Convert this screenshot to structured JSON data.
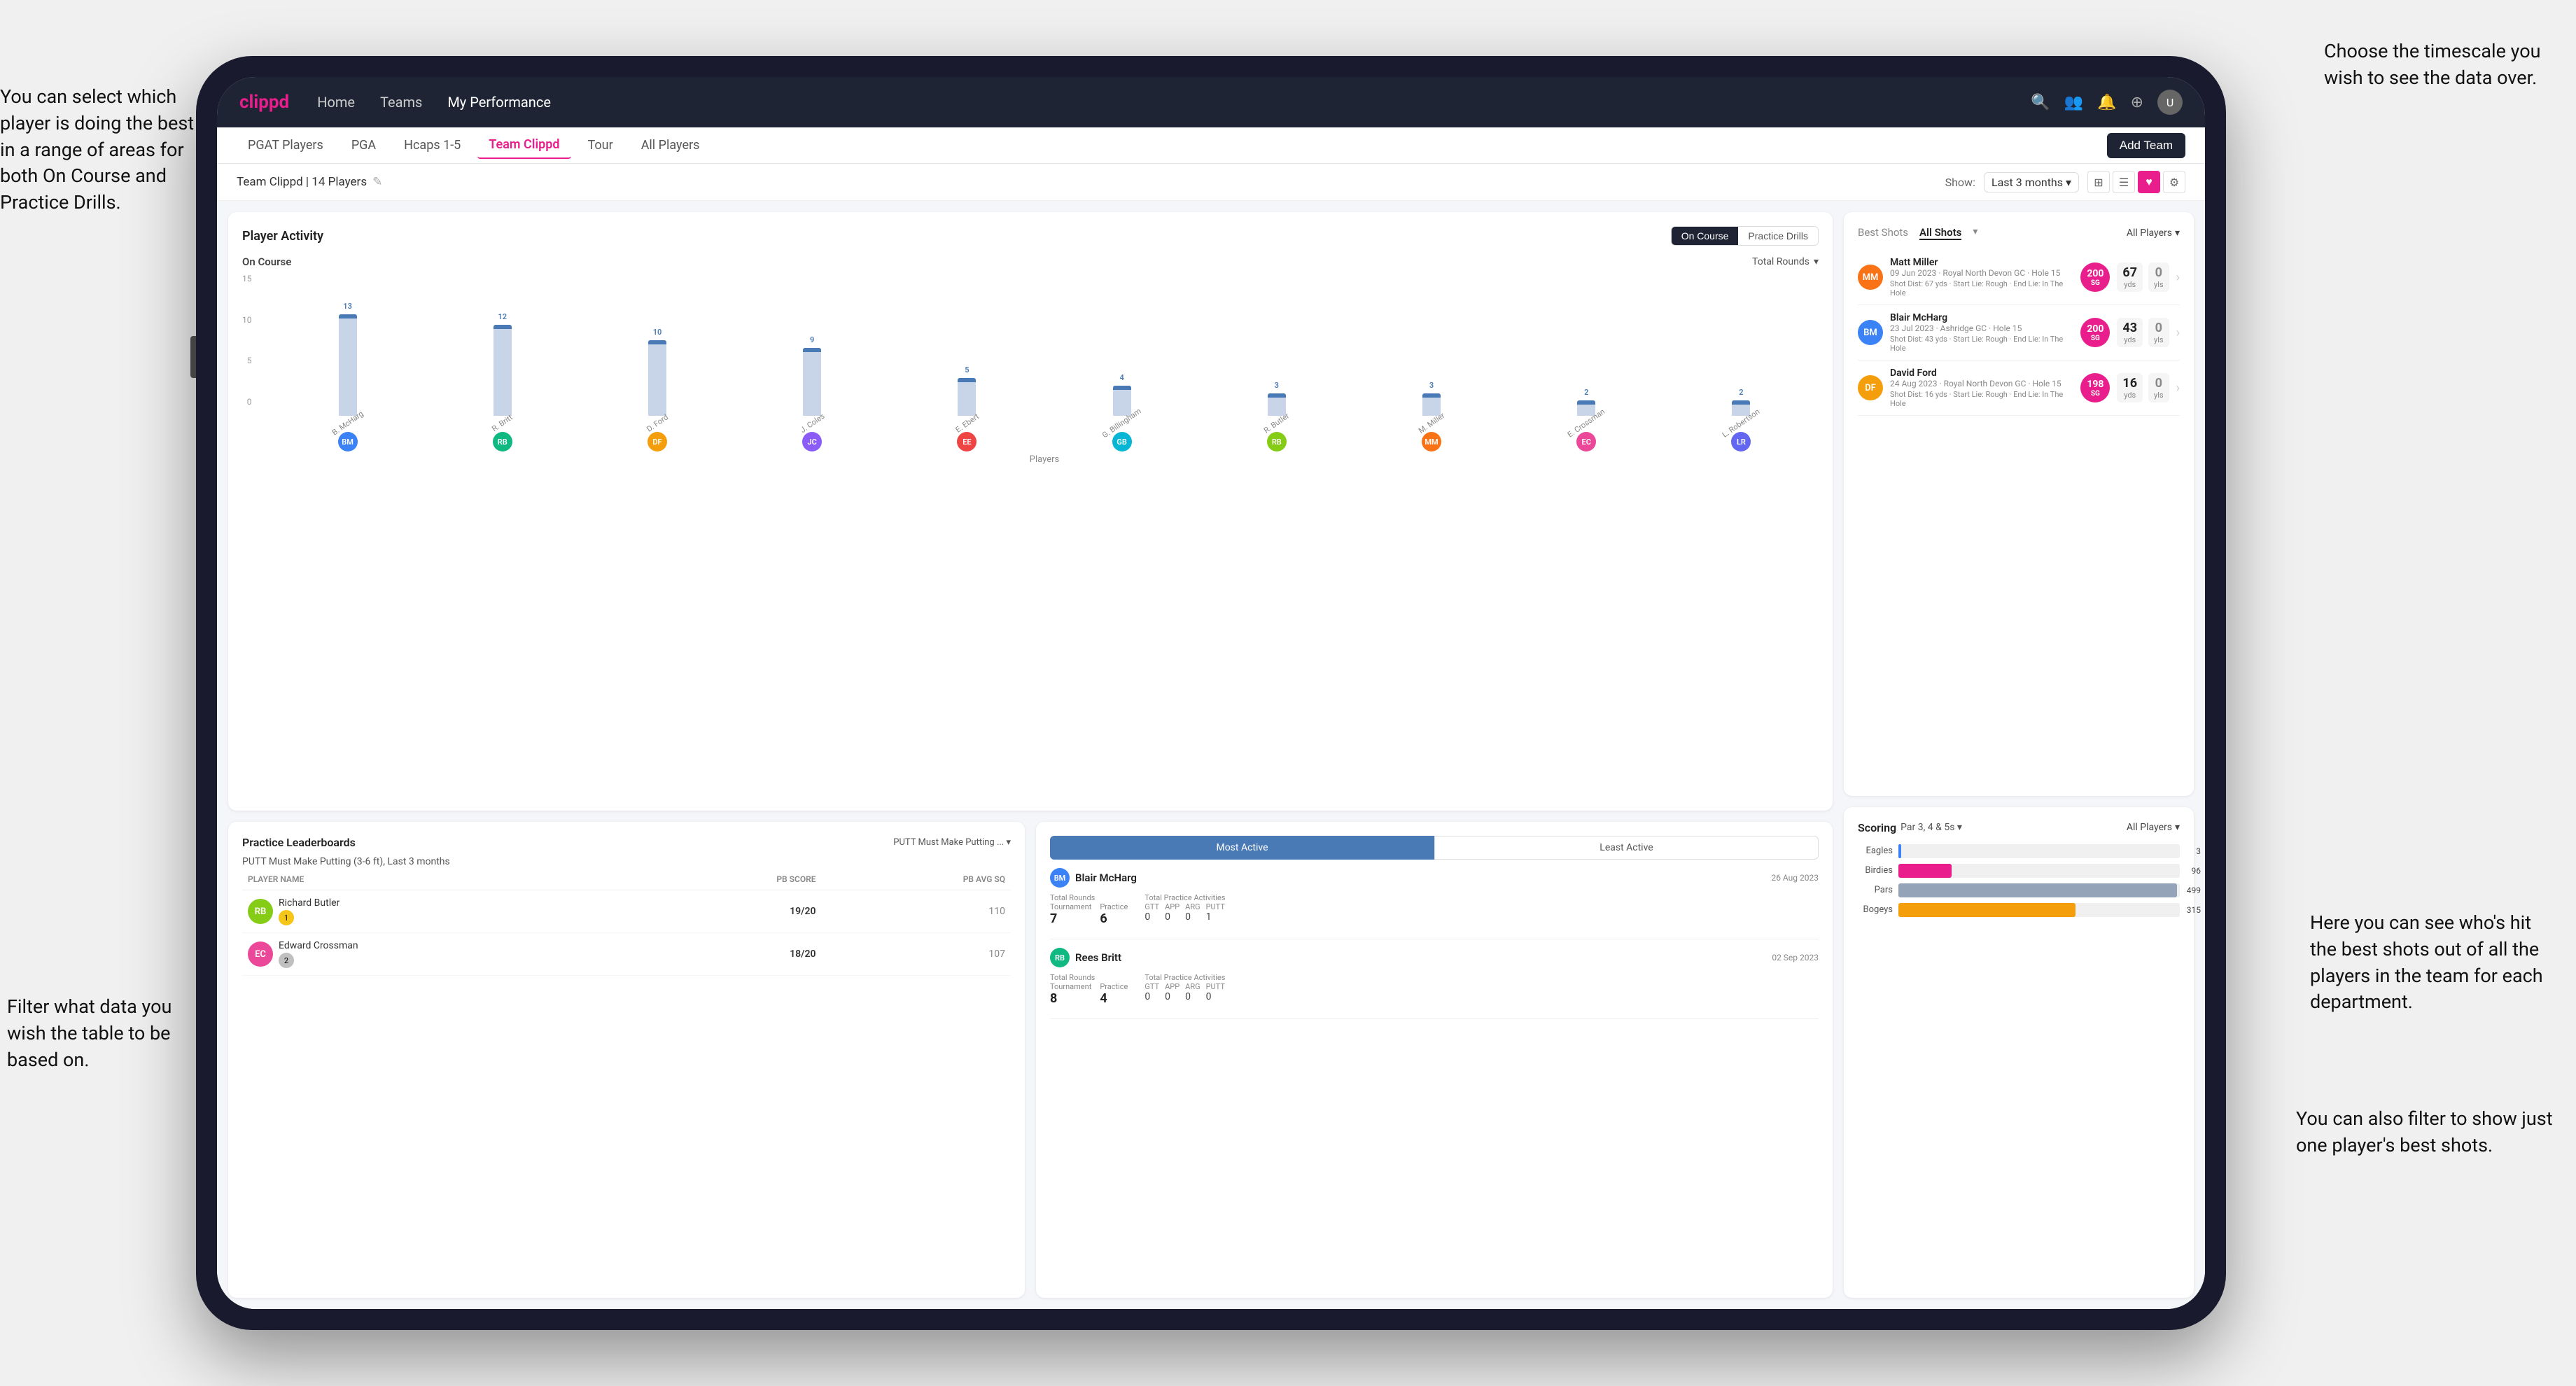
{
  "annotations": {
    "top_right": "Choose the timescale you\nwish to see the data over.",
    "top_left": "You can select which player is\ndoing the best in a range of\nareas for both On Course and\nPractice Drills.",
    "bottom_left": "Filter what data you wish the\ntable to be based on.",
    "bottom_right_1": "Here you can see who's hit\nthe best shots out of all the\nplayers in the team for\neach department.",
    "bottom_right_2": "You can also filter to show\njust one player's best shots."
  },
  "nav": {
    "logo": "clippd",
    "links": [
      "Home",
      "Teams",
      "My Performance"
    ],
    "active_link": "Teams"
  },
  "sub_tabs": {
    "tabs": [
      "PGAT Players",
      "PGA",
      "Hcaps 1-5",
      "Team Clippd",
      "Tour",
      "All Players"
    ],
    "active": "Team Clippd",
    "add_button": "Add Team"
  },
  "team_header": {
    "title": "Team Clippd | 14 Players",
    "show_label": "Show:",
    "show_value": "Last 3 months",
    "view_modes": [
      "grid",
      "list",
      "heart",
      "settings"
    ]
  },
  "player_activity": {
    "title": "Player Activity",
    "toggle": [
      "On Course",
      "Practice Drills"
    ],
    "active_toggle": "On Course",
    "subtitle": "On Course",
    "filter": "Total Rounds",
    "x_label": "Players",
    "y_labels": [
      "15",
      "10",
      "5",
      "0"
    ],
    "bars": [
      {
        "name": "B. McHarg",
        "value": 13,
        "height": 87,
        "color": "#4a7ab5"
      },
      {
        "name": "R. Britt",
        "value": 12,
        "height": 80,
        "color": "#4a7ab5"
      },
      {
        "name": "D. Ford",
        "value": 10,
        "height": 67,
        "color": "#4a7ab5"
      },
      {
        "name": "J. Coles",
        "value": 9,
        "height": 60,
        "color": "#4a7ab5"
      },
      {
        "name": "E. Ebert",
        "value": 5,
        "height": 33,
        "color": "#4a7ab5"
      },
      {
        "name": "G. Billingham",
        "value": 4,
        "height": 27,
        "color": "#4a7ab5"
      },
      {
        "name": "R. Butler",
        "value": 3,
        "height": 20,
        "color": "#4a7ab5"
      },
      {
        "name": "M. Miller",
        "value": 3,
        "height": 20,
        "color": "#4a7ab5"
      },
      {
        "name": "E. Crossman",
        "value": 2,
        "height": 13,
        "color": "#4a7ab5"
      },
      {
        "name": "L. Robertson",
        "value": 2,
        "height": 13,
        "color": "#4a7ab5"
      }
    ],
    "avatar_colors": [
      "#3b82f6",
      "#10b981",
      "#f59e0b",
      "#8b5cf6",
      "#ef4444",
      "#06b6d4",
      "#84cc16",
      "#f97316",
      "#ec4899",
      "#6366f1"
    ]
  },
  "practice_leaderboards": {
    "title": "Practice Leaderboards",
    "filter": "PUTT Must Make Putting ...",
    "drill_title": "PUTT Must Make Putting (3-6 ft), Last 3 months",
    "headers": {
      "name": "PLAYER NAME",
      "score": "PB SCORE",
      "avg": "PB AVG SQ"
    },
    "players": [
      {
        "rank": 1,
        "name": "Richard Butler",
        "score": "19/20",
        "avg": "110",
        "rank_type": "gold"
      },
      {
        "rank": 2,
        "name": "Edward Crossman",
        "score": "18/20",
        "avg": "107",
        "rank_type": "silver"
      }
    ]
  },
  "most_active": {
    "tabs": [
      "Most Active",
      "Least Active"
    ],
    "active_tab": "Most Active",
    "players": [
      {
        "name": "Blair McHarg",
        "date": "26 Aug 2023",
        "total_rounds_label": "Total Rounds",
        "tournament": "7",
        "practice": "6",
        "practice_label": "Total Practice Activities",
        "gtt": "0",
        "app": "0",
        "arg": "0",
        "putt": "1"
      },
      {
        "name": "Rees Britt",
        "date": "02 Sep 2023",
        "total_rounds_label": "Total Rounds",
        "tournament": "8",
        "practice": "4",
        "practice_label": "Total Practice Activities",
        "gtt": "0",
        "app": "0",
        "arg": "0",
        "putt": "0"
      }
    ]
  },
  "best_shots": {
    "title": "Best Shots",
    "tabs": [
      "All Shots",
      "Best"
    ],
    "active_tab": "All Shots",
    "players_filter": "All Players",
    "shots": [
      {
        "player": "Matt Miller",
        "date": "09 Jun 2023",
        "course": "Royal North Devon GC",
        "hole": "Hole 15",
        "badge_text": "200\nSG",
        "badge_type": "red",
        "detail": "Shot Dist: 67 yds\nStart Lie: Rough\nEnd Lie: In The Hole",
        "dist_val": "67",
        "dist_unit": "yds",
        "zero_val": "0",
        "zero_unit": "yls"
      },
      {
        "player": "Blair McHarg",
        "date": "23 Jul 2023",
        "course": "Ashridge GC",
        "hole": "Hole 15",
        "badge_text": "200\nSG",
        "badge_type": "red",
        "detail": "Shot Dist: 43 yds\nStart Lie: Rough\nEnd Lie: In The Hole",
        "dist_val": "43",
        "dist_unit": "yds",
        "zero_val": "0",
        "zero_unit": "yls"
      },
      {
        "player": "David Ford",
        "date": "24 Aug 2023",
        "course": "Royal North Devon GC",
        "hole": "Hole 15",
        "badge_text": "198\nSG",
        "badge_type": "red",
        "detail": "Shot Dist: 16 yds\nStart Lie: Rough\nEnd Lie: In The Hole",
        "dist_val": "16",
        "dist_unit": "yds",
        "zero_val": "0",
        "zero_unit": "yls"
      }
    ]
  },
  "scoring": {
    "title": "Scoring",
    "par_filter": "Par 3, 4 & 5s",
    "players_filter": "All Players",
    "rows": [
      {
        "label": "Eagles",
        "value": 3,
        "max": 500,
        "color": "#3b82f6",
        "pct": 1
      },
      {
        "label": "Birdies",
        "value": 96,
        "max": 500,
        "color": "#e91e8c",
        "pct": 19
      },
      {
        "label": "Pars",
        "value": 499,
        "max": 500,
        "color": "#94a3b8",
        "pct": 99
      },
      {
        "label": "Bogeys",
        "value": 315,
        "max": 500,
        "color": "#f59e0b",
        "pct": 63
      }
    ]
  }
}
